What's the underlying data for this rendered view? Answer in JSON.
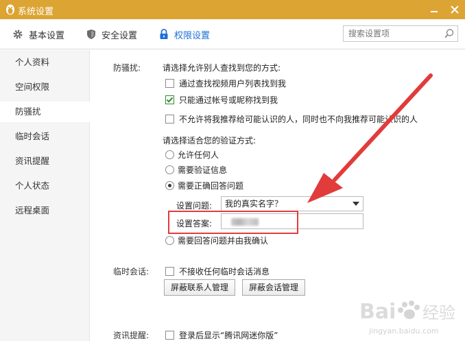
{
  "window": {
    "title": "系统设置",
    "icons": {
      "app": "penguin-icon",
      "minimize": "minimize-icon",
      "close": "close-icon"
    }
  },
  "topbar": {
    "tabs": [
      {
        "label": "基本设置",
        "icon": "gear-icon"
      },
      {
        "label": "安全设置",
        "icon": "shield-icon"
      },
      {
        "label": "权限设置",
        "icon": "lock-icon",
        "active": true
      }
    ],
    "search": {
      "placeholder": "搜索设置项",
      "value": ""
    },
    "accent_color": "#1d6fd6"
  },
  "sidebar": {
    "items": [
      {
        "label": "个人资料"
      },
      {
        "label": "空间权限"
      },
      {
        "label": "防骚扰",
        "active": true
      },
      {
        "label": "临时会话"
      },
      {
        "label": "资讯提醒"
      },
      {
        "label": "个人状态"
      },
      {
        "label": "远程桌面"
      }
    ]
  },
  "anti_harass": {
    "section_label": "防骚扰:",
    "find_prompt": "请选择允许别人查找到您的方式:",
    "find_options": [
      {
        "label": "通过查找视频用户列表找到我",
        "checked": false
      },
      {
        "label": "只能通过帐号或昵称找到我",
        "checked": true
      },
      {
        "label": "不允许将我推荐给可能认识的人，同时也不向我推荐可能认识的人",
        "checked": false
      }
    ],
    "verify_prompt": "请选择适合您的验证方式:",
    "verify_options": [
      {
        "label": "允许任何人",
        "checked": false
      },
      {
        "label": "需要验证信息",
        "checked": false
      },
      {
        "label": "需要正确回答问题",
        "checked": true
      }
    ],
    "question_label": "设置问题:",
    "question_value": "我的真实名字？",
    "answer_label": "设置答案:",
    "last_verify_option": {
      "label": "需要回答问题并由我确认",
      "checked": false
    }
  },
  "temp_session": {
    "section_label": "临时会话:",
    "option": {
      "label": "不接收任何临时会话消息",
      "checked": false
    },
    "buttons": {
      "block_contacts": "屏蔽联系人管理",
      "block_sessions": "屏蔽会话管理"
    }
  },
  "news": {
    "section_label": "资讯提醒:",
    "option": {
      "label": "登录后显示“腾讯网迷你版”",
      "checked": false
    }
  },
  "annotation": {
    "color": "#e23b3b"
  },
  "watermark": {
    "text": "Bai 经验",
    "sub": "jingyan.baidu.com"
  }
}
